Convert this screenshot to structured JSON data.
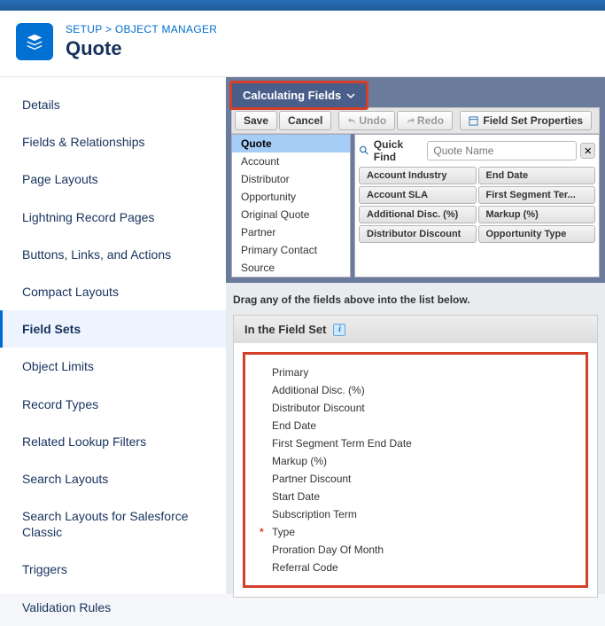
{
  "breadcrumb": {
    "setup": "SETUP",
    "sep": ">",
    "objmgr": "OBJECT MANAGER"
  },
  "page_title": "Quote",
  "sidebar": {
    "items": [
      "Details",
      "Fields & Relationships",
      "Page Layouts",
      "Lightning Record Pages",
      "Buttons, Links, and Actions",
      "Compact Layouts",
      "Field Sets",
      "Object Limits",
      "Record Types",
      "Related Lookup Filters",
      "Search Layouts",
      "Search Layouts for Salesforce Classic",
      "Triggers",
      "Validation Rules"
    ],
    "active_index": 6
  },
  "panel_bar": {
    "label": "Calculating Fields"
  },
  "toolbar": {
    "save": "Save",
    "cancel": "Cancel",
    "undo": "Undo",
    "redo": "Redo",
    "props": "Field Set Properties"
  },
  "palette": {
    "objects": [
      "Quote",
      "Account",
      "Distributor",
      "Opportunity",
      "Original Quote",
      "Partner",
      "Primary Contact",
      "Source"
    ],
    "selected_index": 0,
    "quickfind_label": "Quick Find",
    "quickfind_placeholder": "Quote Name",
    "fields": [
      "Account Industry",
      "End Date",
      "Account SLA",
      "First Segment Ter...",
      "Additional Disc. (%)",
      "Markup (%)",
      "Distributor Discount",
      "Opportunity Type"
    ]
  },
  "instruction_text": "Drag any of the fields above into the list below.",
  "fieldset": {
    "header": "In the Field Set",
    "items": [
      {
        "label": "Primary",
        "required": false
      },
      {
        "label": "Additional Disc. (%)",
        "required": false
      },
      {
        "label": "Distributor Discount",
        "required": false
      },
      {
        "label": "End Date",
        "required": false
      },
      {
        "label": "First Segment Term End Date",
        "required": false
      },
      {
        "label": "Markup (%)",
        "required": false
      },
      {
        "label": "Partner Discount",
        "required": false
      },
      {
        "label": "Start Date",
        "required": false
      },
      {
        "label": "Subscription Term",
        "required": false
      },
      {
        "label": "Type",
        "required": true
      },
      {
        "label": "Proration Day Of Month",
        "required": false
      },
      {
        "label": "Referral Code",
        "required": false
      }
    ]
  }
}
